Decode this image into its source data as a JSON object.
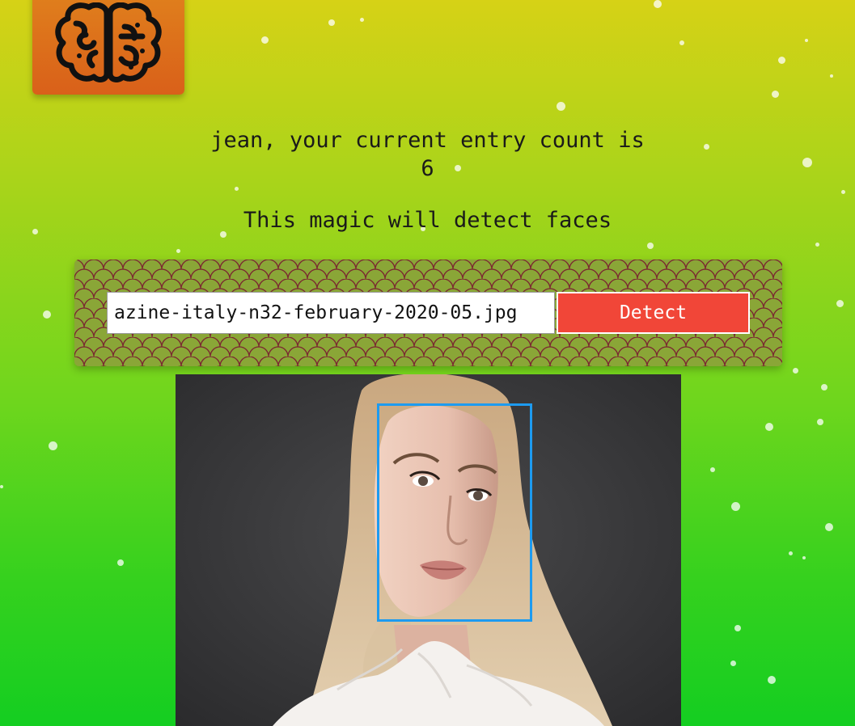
{
  "app": {
    "logo_icon": "brain-icon",
    "accent_color": "#f14638",
    "face_box_color": "#1d9bf0"
  },
  "greeting": {
    "line1": "jean, your current entry count is",
    "line2": "6"
  },
  "subtitle": "This magic will detect faces",
  "form": {
    "image_url": "azine-italy-n32-february-2020-05.jpg",
    "detect_label": "Detect"
  },
  "result": {
    "faces_detected": 1
  }
}
